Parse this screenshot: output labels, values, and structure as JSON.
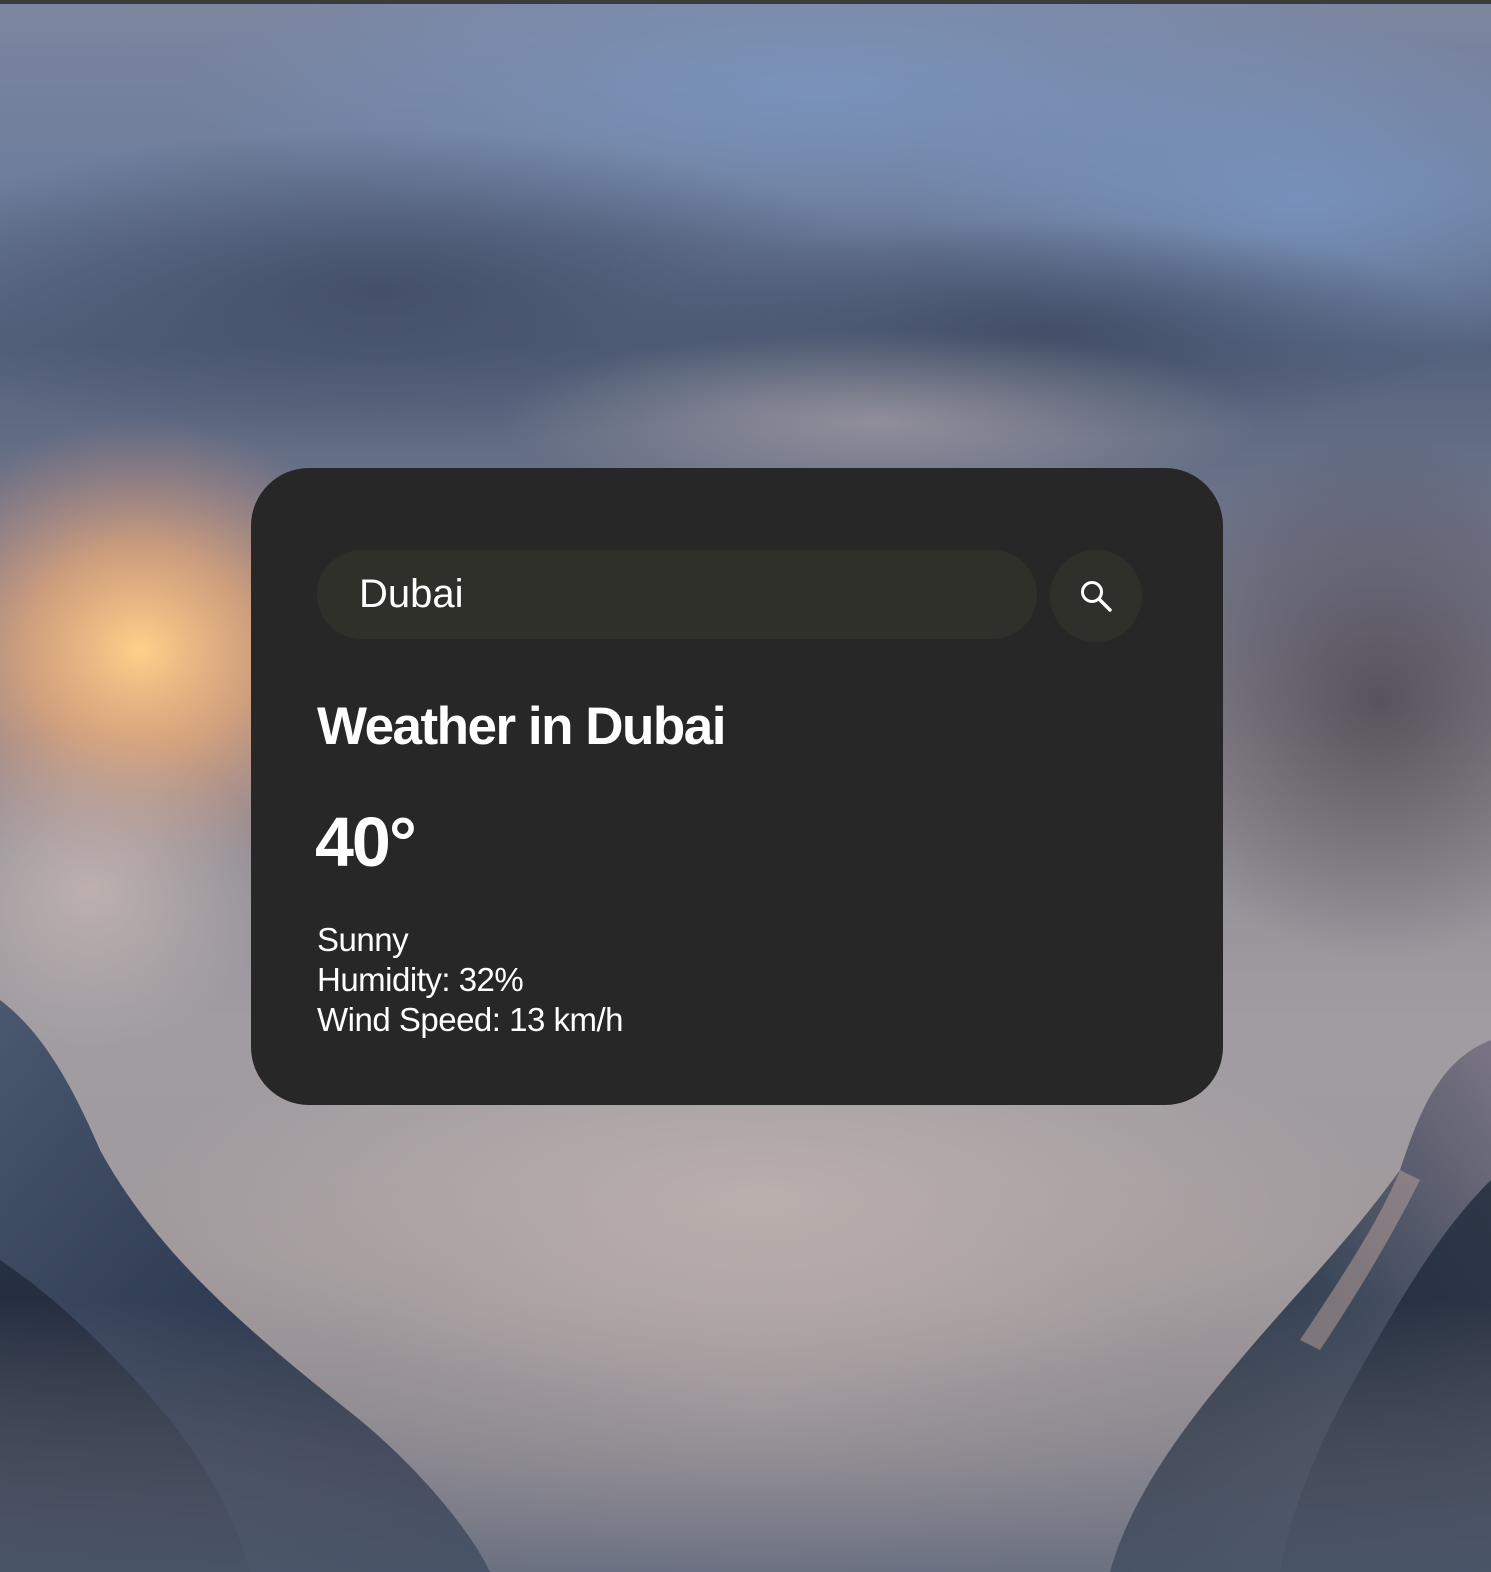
{
  "search": {
    "value": "Dubai",
    "icon": "search-icon"
  },
  "weather": {
    "title": "Weather in Dubai",
    "temperature": "40°",
    "description": "Sunny",
    "humidity": "Humidity: 32%",
    "wind": "Wind Speed: 13 km/h"
  },
  "colors": {
    "card": "#272727",
    "input": "#30302b",
    "text": "#ffffff"
  }
}
